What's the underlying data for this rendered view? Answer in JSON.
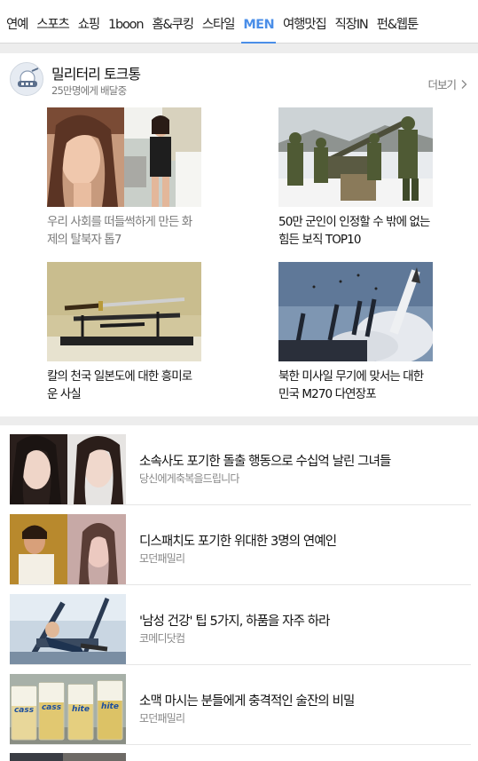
{
  "nav": {
    "tabs": [
      "연예",
      "스포츠",
      "쇼핑",
      "1boon",
      "홈&쿠킹",
      "스타일",
      "MEN",
      "여행맛집",
      "직장IN",
      "펀&웹툰"
    ],
    "active_index": 6,
    "accent": "#4a8ee8"
  },
  "channel": {
    "title": "밀리터리 토크통",
    "subtitle": "25만명에게 배달중",
    "more_label": "더보기",
    "tiles": [
      {
        "caption": "우리 사회를 떠들썩하게 만든 화제의 탈북자 톱7",
        "read": true
      },
      {
        "caption": "50만 군인이 인정할 수 밖에 없는 힘든 보직 TOP10",
        "read": false
      },
      {
        "caption": "칼의 천국 일본도에 대한 흥미로운 사실",
        "read": false
      },
      {
        "caption": "북한 미사일 무기에 맞서는 대한민국 M270 다연장포",
        "read": false
      }
    ]
  },
  "list": [
    {
      "title": "소속사도 포기한 돌출 행동으로 수십억 날린 그녀들",
      "source": "당신에게축복을드립니다"
    },
    {
      "title": "디스패치도 포기한 위대한 3명의 연예인",
      "source": "모던패밀리"
    },
    {
      "title": "'남성 건강' 팁 5가지, 하품을 자주 하라",
      "source": "코메디닷컴"
    },
    {
      "title": "소맥 마시는 분들에게 충격적인 술잔의 비밀",
      "source": "모던패밀리"
    }
  ],
  "beer_labels": [
    "cass",
    "cass",
    "hite",
    "hite"
  ]
}
